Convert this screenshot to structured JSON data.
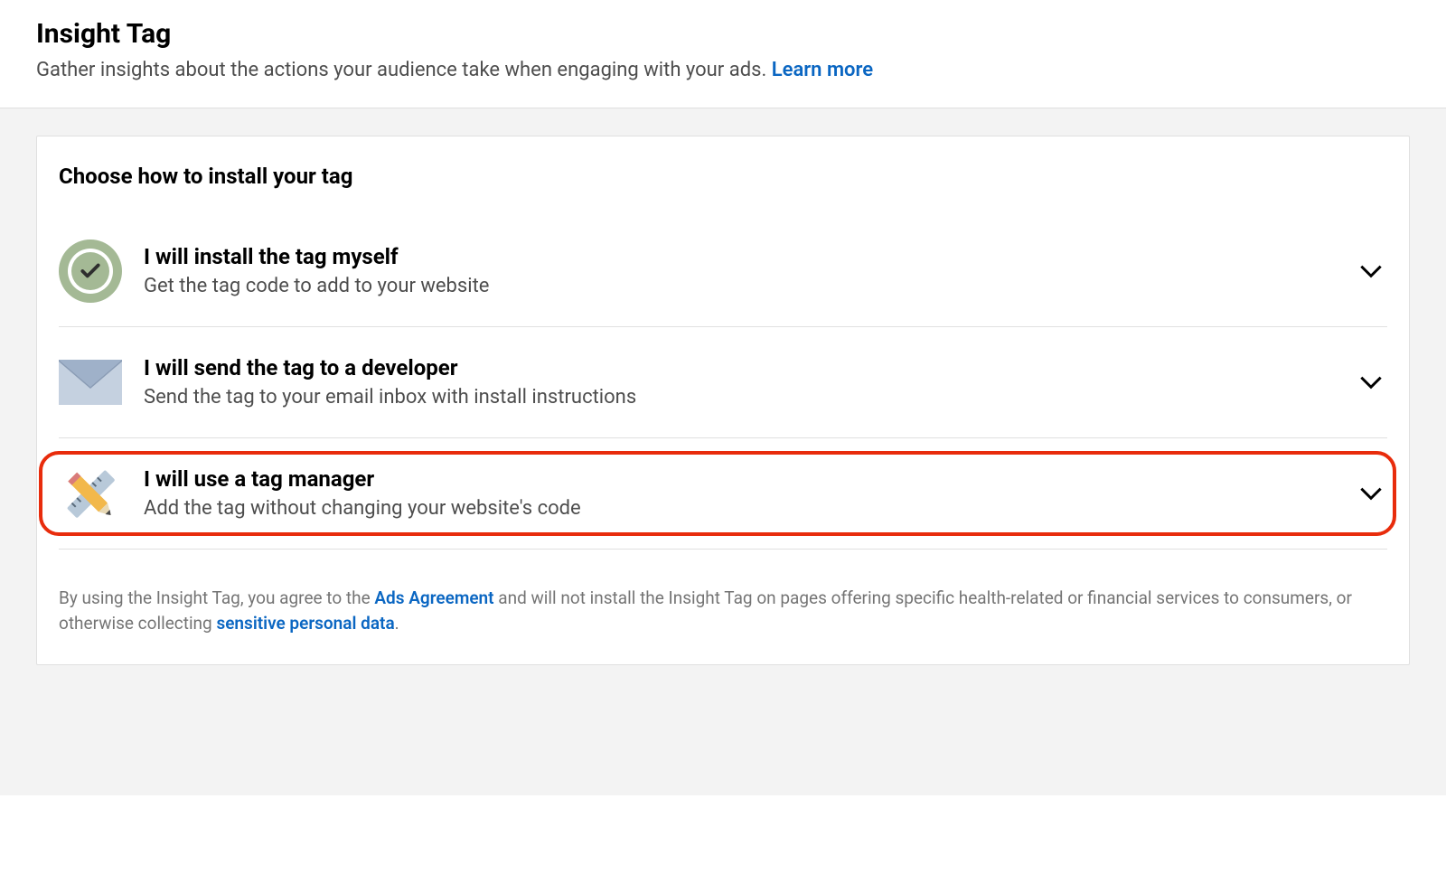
{
  "header": {
    "title": "Insight Tag",
    "subtitle": "Gather insights about the actions your audience take when engaging with your ads. ",
    "learn_more": "Learn more"
  },
  "card": {
    "title": "Choose how to install your tag",
    "options": [
      {
        "icon": "checkmark-circle-icon",
        "title": "I will install the tag myself",
        "subtitle": "Get the tag code to add to your website",
        "highlighted": false
      },
      {
        "icon": "envelope-icon",
        "title": "I will send the tag to a developer",
        "subtitle": "Send the tag to your email inbox with install instructions",
        "highlighted": false
      },
      {
        "icon": "ruler-pencil-icon",
        "title": "I will use a tag manager",
        "subtitle": "Add the tag without changing your website's code",
        "highlighted": true
      }
    ],
    "footer": {
      "prefix": "By using the Insight Tag, you agree to the ",
      "link1": "Ads Agreement",
      "middle": " and will not install the Insight Tag on pages offering specific health-related or financial services to consumers, or otherwise collecting ",
      "link2": "sensitive personal data",
      "suffix": "."
    }
  }
}
